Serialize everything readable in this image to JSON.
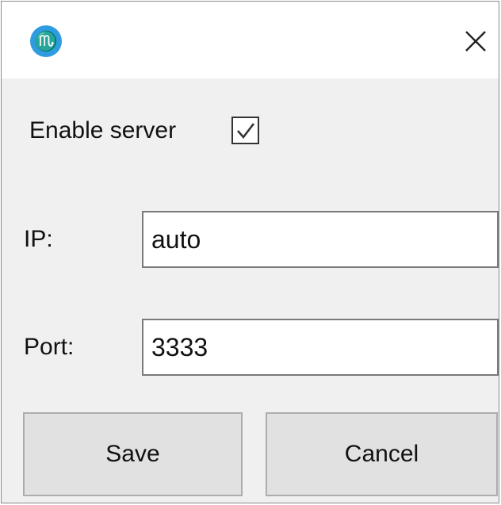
{
  "titlebar": {
    "app_icon_glyph": "♏",
    "app_icon_color": "#2f9be0",
    "close_icon": "close-icon"
  },
  "server": {
    "enable_label": "Enable server",
    "enabled": true
  },
  "ip": {
    "label": "IP:",
    "value": "auto"
  },
  "port": {
    "label": "Port:",
    "value": "3333"
  },
  "buttons": {
    "save_label": "Save",
    "cancel_label": "Cancel"
  }
}
